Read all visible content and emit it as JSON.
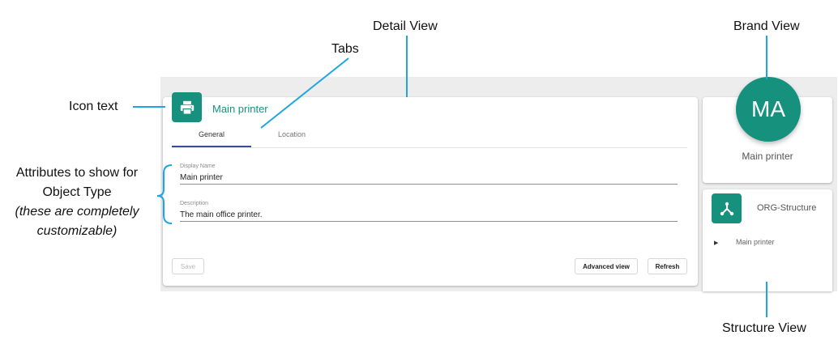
{
  "annotations": {
    "detail_view": "Detail View",
    "brand_view": "Brand View",
    "tabs": "Tabs",
    "icon_text": "Icon text",
    "attributes_line1": "Attributes to show for",
    "attributes_line2": "Object Type",
    "attributes_line3": "(these are completely",
    "attributes_line4": "customizable)",
    "structure_view": "Structure View"
  },
  "detail": {
    "title": "Main printer",
    "icon": "printer-icon",
    "tabs": [
      {
        "label": "General",
        "selected": true
      },
      {
        "label": "Location",
        "selected": false
      }
    ],
    "fields": [
      {
        "label": "Display Name",
        "value": "Main printer"
      },
      {
        "label": "Description",
        "value": "The main office printer."
      }
    ],
    "buttons": {
      "save": "Save",
      "advanced_view": "Advanced view",
      "refresh": "Refresh"
    }
  },
  "brand": {
    "initials": "MA",
    "name": "Main printer"
  },
  "structure": {
    "icon": "hierarchy-icon",
    "title": "ORG-Structure",
    "items": [
      {
        "label": "Main printer"
      }
    ]
  },
  "colors": {
    "accent": "#16917e",
    "callout_line": "#1da6df",
    "tab_indicator": "#3c4a9e",
    "app_background": "#ededed"
  }
}
